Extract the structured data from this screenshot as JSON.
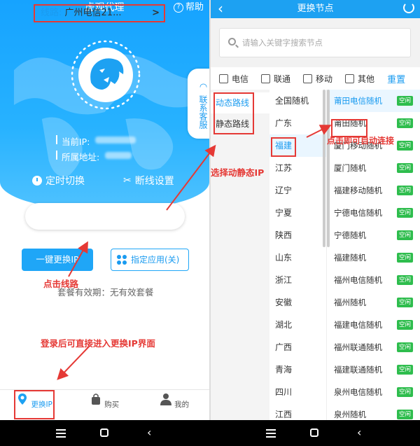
{
  "left": {
    "app_title": "虎观代理",
    "help_label": "帮助",
    "current_ip_label": "当前IP:",
    "location_label": "所属地址:",
    "timer_switch_label": "定时切换",
    "disconnect_setting_label": "断线设置",
    "side_tab_label": "联系客服",
    "line_label": "线路:",
    "line_value": "广州电信21...",
    "one_click_change_label": "一键更换IP",
    "specify_app_label": "指定应用(关)",
    "validity_text": "套餐有效期：无有效套餐",
    "nav": [
      {
        "label": "更换IP",
        "icon": "location-pin-icon",
        "active": true
      },
      {
        "label": "购买",
        "icon": "shopping-bag-icon",
        "active": false
      },
      {
        "label": "我的",
        "icon": "user-icon",
        "active": false
      }
    ]
  },
  "right": {
    "title": "更换节点",
    "search_placeholder": "请输入关键字搜索节点",
    "filters": [
      "电信",
      "联通",
      "移动",
      "其他"
    ],
    "reset_label": "重置",
    "route_types": [
      {
        "label": "动态路线",
        "selected": true
      },
      {
        "label": "静态路线",
        "selected": false
      }
    ],
    "provinces": [
      {
        "label": "全国随机",
        "selected": false
      },
      {
        "label": "广东",
        "selected": false
      },
      {
        "label": "福建",
        "selected": true
      },
      {
        "label": "江苏",
        "selected": false
      },
      {
        "label": "辽宁",
        "selected": false
      },
      {
        "label": "宁夏",
        "selected": false
      },
      {
        "label": "陕西",
        "selected": false
      },
      {
        "label": "山东",
        "selected": false
      },
      {
        "label": "浙江",
        "selected": false
      },
      {
        "label": "安徽",
        "selected": false
      },
      {
        "label": "湖北",
        "selected": false
      },
      {
        "label": "广西",
        "selected": false
      },
      {
        "label": "青海",
        "selected": false
      },
      {
        "label": "四川",
        "selected": false
      },
      {
        "label": "江西",
        "selected": false
      }
    ],
    "nodes": [
      {
        "label": "莆田电信随机",
        "status": "空闲",
        "selected": true
      },
      {
        "label": "莆田随机",
        "status": "空闲",
        "selected": false
      },
      {
        "label": "厦门移动随机",
        "status": "空闲",
        "selected": false
      },
      {
        "label": "厦门随机",
        "status": "空闲",
        "selected": false
      },
      {
        "label": "福建移动随机",
        "status": "空闲",
        "selected": false
      },
      {
        "label": "宁德电信随机",
        "status": "空闲",
        "selected": false
      },
      {
        "label": "宁德随机",
        "status": "空闲",
        "selected": false
      },
      {
        "label": "福建随机",
        "status": "空闲",
        "selected": false
      },
      {
        "label": "福州电信随机",
        "status": "空闲",
        "selected": false
      },
      {
        "label": "福州随机",
        "status": "空闲",
        "selected": false
      },
      {
        "label": "福建电信随机",
        "status": "空闲",
        "selected": false
      },
      {
        "label": "福州联通随机",
        "status": "空闲",
        "selected": false
      },
      {
        "label": "福建联通随机",
        "status": "空闲",
        "selected": false
      },
      {
        "label": "泉州电信随机",
        "status": "空闲",
        "selected": false
      },
      {
        "label": "泉州随机",
        "status": "空闲",
        "selected": false
      }
    ]
  },
  "annotations": {
    "click_line": "点击线路",
    "select_route": "选择动静态IP",
    "click_connect": "点击即可自动连接",
    "login_direct": "登录后可直接进入更换IP界面"
  },
  "colors": {
    "primary": "#1da1f2",
    "annotation_red": "#e53935",
    "status_green": "#2ebd4d"
  }
}
